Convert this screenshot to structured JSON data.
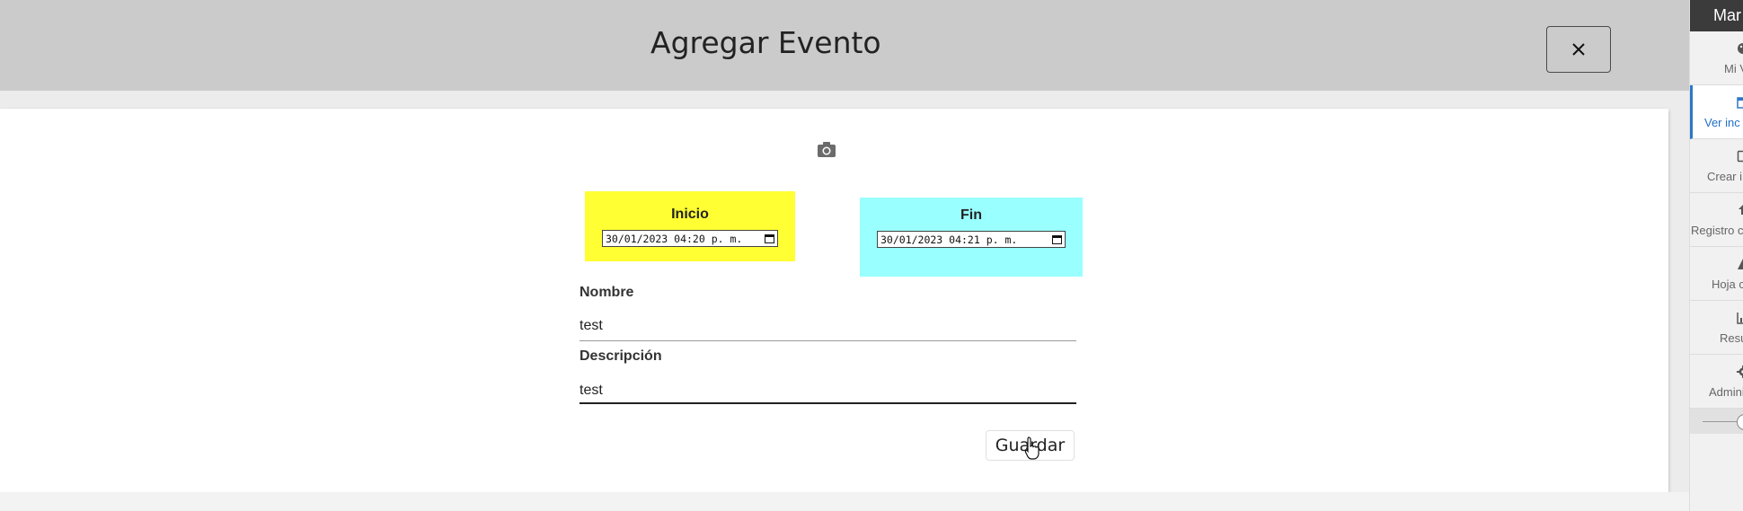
{
  "modal": {
    "title": "Agregar Evento",
    "close_symbol": "×"
  },
  "dates": {
    "start": {
      "label": "Inicio",
      "value": "30/01/2023 04:20 p. m."
    },
    "end": {
      "label": "Fin",
      "value": "30/01/2023 04:21 p. m."
    }
  },
  "form": {
    "name": {
      "label": "Nombre",
      "value": "test"
    },
    "description": {
      "label": "Descripción",
      "value": "test"
    },
    "save_label": "Guardar"
  },
  "sidebar": {
    "header": "Mar",
    "items": [
      {
        "label": "Mi V",
        "icon": "palette-icon"
      },
      {
        "label": "Ver inc",
        "icon": "calendar-icon"
      },
      {
        "label": "Crear i",
        "icon": "square-icon"
      },
      {
        "label": "Registro c",
        "icon": "upload-icon"
      },
      {
        "label": "Hoja c",
        "icon": "warning-icon"
      },
      {
        "label": "Resu",
        "icon": "chart-icon"
      },
      {
        "label": "Admini",
        "icon": "gear-icon"
      }
    ]
  },
  "colors": {
    "start_bg": "#ffff33",
    "end_bg": "#99ffff",
    "header_bg": "#cbcbcb",
    "active_accent": "#2b78c5"
  }
}
